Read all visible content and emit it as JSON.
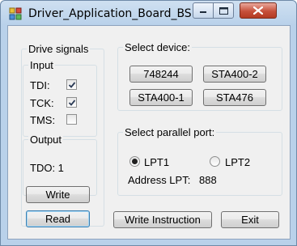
{
  "window": {
    "title": "Driver_Application_Board_BS",
    "app_icon": "app-icon",
    "minimize_icon": "minimize-icon",
    "maximize_icon": "maximize-icon",
    "close_icon": "close-icon"
  },
  "drive_signals": {
    "title": "Drive signals",
    "input": {
      "title": "Input",
      "signals": [
        {
          "label": "TDI:",
          "checked": true
        },
        {
          "label": "TCK:",
          "checked": true
        },
        {
          "label": "TMS:",
          "checked": false
        }
      ]
    },
    "output": {
      "title": "Output",
      "tdo_label": "TDO: 1"
    },
    "write_button": "Write",
    "read_button": "Read"
  },
  "select_device": {
    "title": "Select device:",
    "devices": [
      "748244",
      "STA400-2",
      "STA400-1",
      "STA476"
    ]
  },
  "select_port": {
    "title": "Select parallel port:",
    "options": [
      {
        "label": "LPT1",
        "selected": true
      },
      {
        "label": "LPT2",
        "selected": false
      }
    ],
    "address_label": "Address LPT:",
    "address_value": "888"
  },
  "footer": {
    "write_instruction_button": "Write Instruction",
    "exit_button": "Exit"
  }
}
